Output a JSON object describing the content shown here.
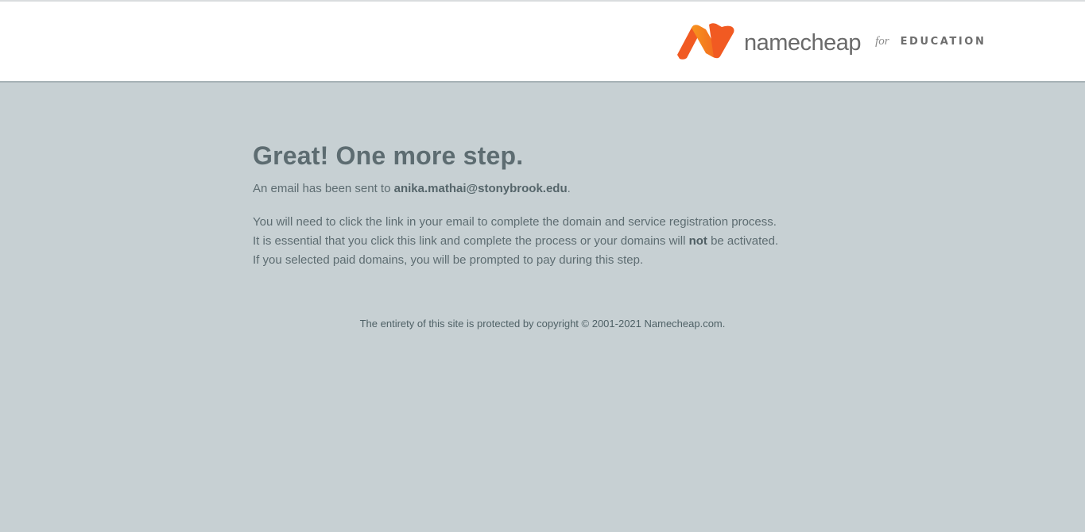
{
  "brand": {
    "logo": "namecheap-logo-icon",
    "name": "namecheap",
    "for": "for",
    "education": "EDUCATION",
    "colors": {
      "logo_dark": "#f15a22",
      "logo_light": "#f7941d",
      "text": "#6a6a6a"
    }
  },
  "main": {
    "title": "Great! One more step.",
    "sent_prefix": "An email has been sent to ",
    "email": "anika.mathai@stonybrook.edu",
    "sent_suffix": ".",
    "line1": "You will need to click the link in your email to complete the domain and service registration process.",
    "line2_prefix": "It is essential that you click this link and complete the process or your domains will ",
    "line2_bold": "not",
    "line2_suffix": " be activated.",
    "line3": "If you selected paid domains, you will be prompted to pay during this step."
  },
  "footer": {
    "copyright": "The entirety of this site is protected by copyright © 2001-2021 Namecheap.com."
  },
  "colors": {
    "background": "#c7d0d3",
    "header_bg": "#ffffff",
    "text": "#5d6c71"
  }
}
